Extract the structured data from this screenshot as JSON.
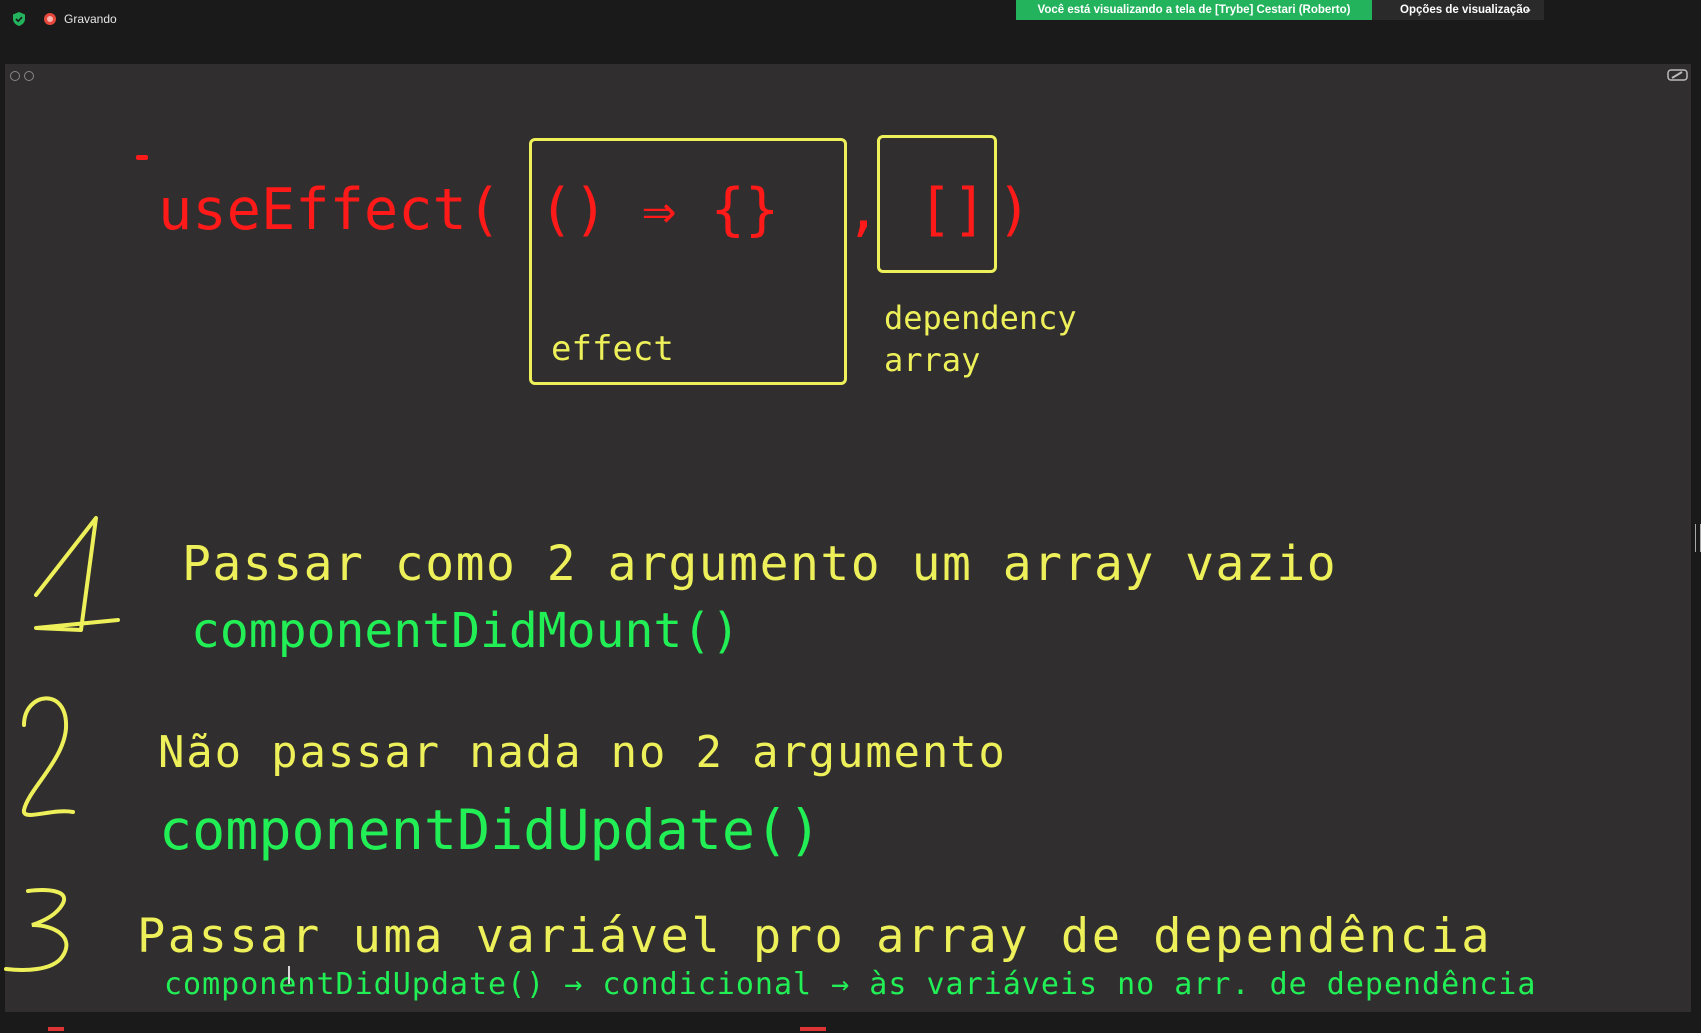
{
  "meeting_bar": {
    "recording_label": "Gravando",
    "share_banner": "Você está visualizando a tela de [Trybe] Cestari (Roberto)",
    "view_options": "Opções de visualização"
  },
  "icons": {
    "security": "shield-check-icon",
    "recording": "record-icon",
    "chevron": "chevron-down-icon",
    "annotate": "pen-icon",
    "zoom_in": "zoom-in-icon",
    "zoom_out": "zoom-out-icon"
  },
  "colors": {
    "code": "#ff1a1a",
    "text": "#eef05a",
    "method": "#22ee55",
    "banner": "#23b35d",
    "board": "#302e2f"
  },
  "board": {
    "code": {
      "fn": "useEffect(",
      "effect_fn": "() ⇒ {}",
      "comma": ",",
      "deps": "[]",
      "close": ")"
    },
    "labels": {
      "effect": "effect",
      "dependency_line1": "dependency",
      "dependency_line2": "array"
    },
    "items": [
      {
        "number": "1",
        "description": "Passar como 2 argumento um array vazio",
        "lifecycle": "componentDidMount()"
      },
      {
        "number": "2",
        "description": "Não passar nada no 2 argumento",
        "lifecycle": "componentDidUpdate()"
      },
      {
        "number": "3",
        "description": "Passar uma variável pro array de dependência",
        "lifecycle": "componentDidUpdate() → condicional → às variáveis no arr. de dependência"
      }
    ]
  }
}
